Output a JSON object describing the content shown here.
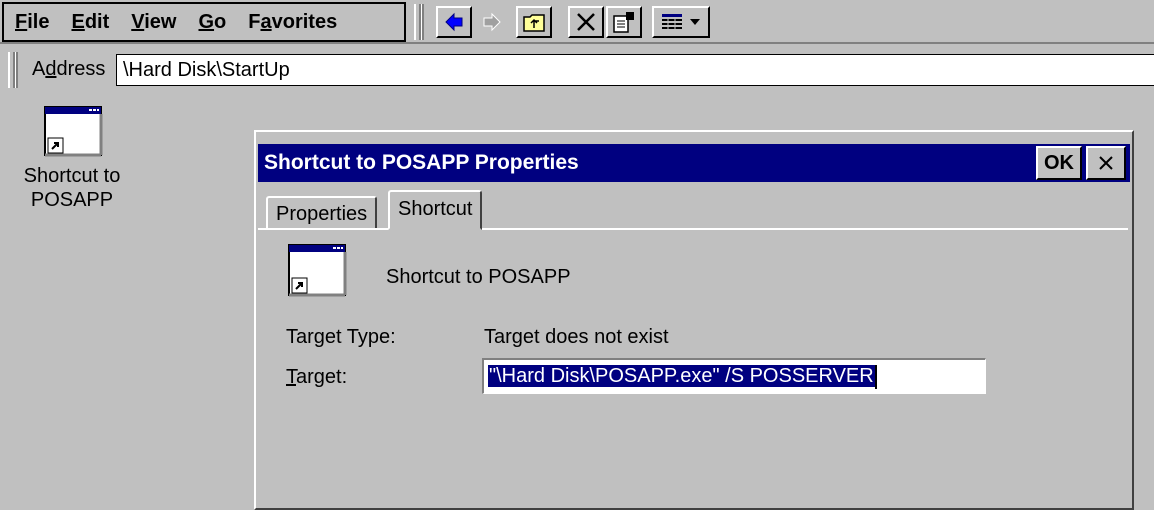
{
  "menubar": {
    "items": [
      {
        "label": "File",
        "accel": "F",
        "rest": "ile"
      },
      {
        "label": "Edit",
        "accel": "E",
        "rest": "dit"
      },
      {
        "label": "View",
        "accel": "V",
        "rest": "iew"
      },
      {
        "label": "Go",
        "accel": "G",
        "rest": "o"
      },
      {
        "label": "Favorites",
        "pre": "F",
        "accel": "a",
        "rest": "vorites"
      }
    ]
  },
  "toolbar": {
    "buttons": [
      {
        "name": "back-button",
        "icon": "back-arrow-icon"
      },
      {
        "name": "forward-button",
        "icon": "forward-arrow-icon"
      },
      {
        "name": "up-folder-button",
        "icon": "up-folder-icon"
      },
      {
        "name": "delete-button",
        "icon": "delete-x-icon"
      },
      {
        "name": "properties-button",
        "icon": "properties-icon"
      },
      {
        "name": "views-button",
        "icon": "views-list-icon"
      }
    ],
    "colors": {
      "accent_blue": "#0000ff",
      "disabled_gray": "#808080"
    }
  },
  "address": {
    "label_pre": "A",
    "label_accel": "d",
    "label_rest": "dress",
    "value": "\\Hard Disk\\StartUp"
  },
  "desktop": {
    "icon_label": "Shortcut to POSAPP"
  },
  "dialog": {
    "title": "Shortcut to POSAPP Properties",
    "ok_label": "OK",
    "close_label": "×",
    "tabs": [
      {
        "label": "Properties",
        "active": false
      },
      {
        "label": "Shortcut",
        "active": true
      }
    ],
    "shortcut_name": "Shortcut to POSAPP",
    "target_type_label": "Target Type:",
    "target_type_value": "Target does not exist",
    "target_label_accel": "T",
    "target_label_rest": "arget:",
    "target_value": "\"\\Hard Disk\\POSAPP.exe\" /S POSSERVER",
    "colors": {
      "title_bar": "#000080",
      "selection": "#000080",
      "face": "#c0c0c0"
    }
  }
}
